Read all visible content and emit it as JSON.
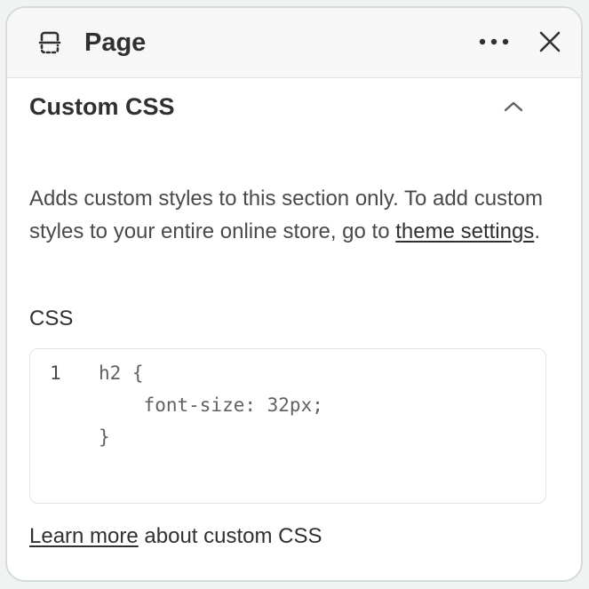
{
  "header": {
    "title": "Page",
    "page_icon": "page-section-icon",
    "more_icon": "more-horizontal-icon",
    "close_icon": "close-icon"
  },
  "section": {
    "title": "Custom CSS",
    "collapse_icon": "chevron-up-icon"
  },
  "description": {
    "text_before": "Adds custom styles to this section only. To add custom styles to your entire online store, go to ",
    "link_text": "theme settings",
    "text_after": "."
  },
  "css_field": {
    "label": "CSS",
    "line_number": "1",
    "code_lines": [
      "h2 {",
      "    font-size: 32px;",
      "}"
    ]
  },
  "footer": {
    "link_text": "Learn more",
    "text_after": " about custom CSS"
  }
}
